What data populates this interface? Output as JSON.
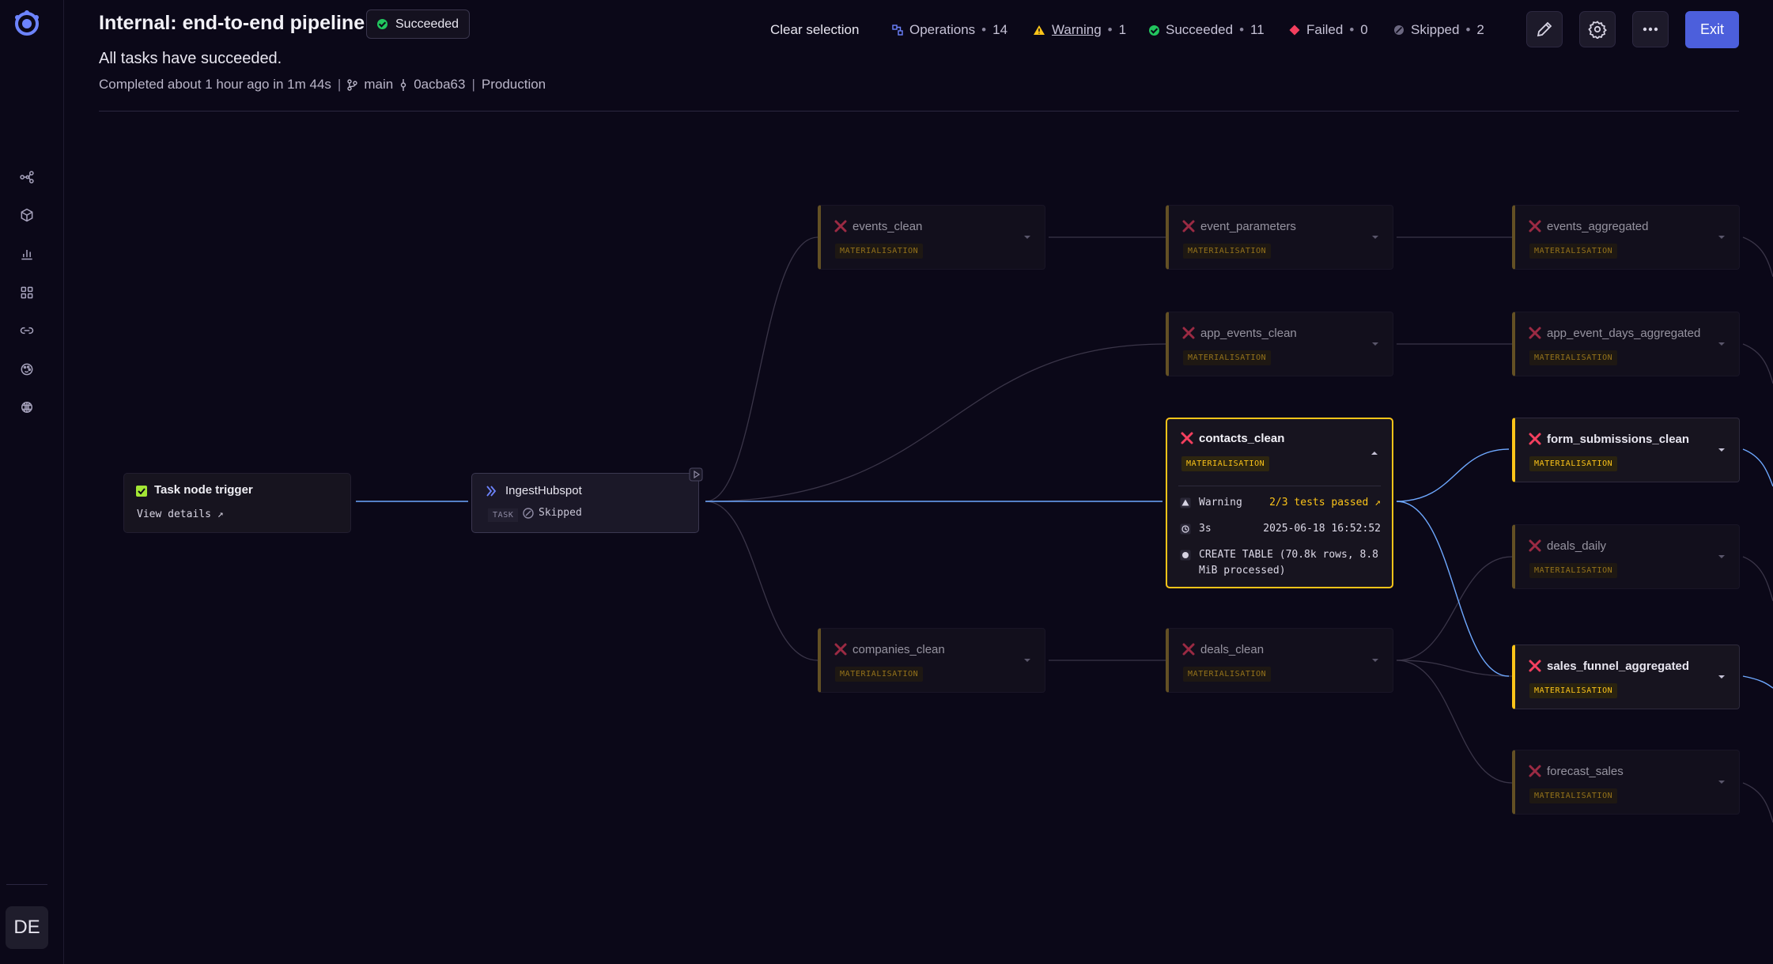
{
  "header": {
    "title": "Internal: end-to-end pipeline",
    "status": "Succeeded",
    "subtitle": "All tasks have succeeded.",
    "completed": "Completed about 1 hour ago in 1m 44s",
    "branch": "main",
    "commit": "0acba63",
    "environment": "Production"
  },
  "toolbar": {
    "clear_selection": "Clear selection",
    "operations_label": "Operations",
    "operations_count": "14",
    "warning_label": "Warning",
    "warning_count": "1",
    "succeeded_label": "Succeeded",
    "succeeded_count": "11",
    "failed_label": "Failed",
    "failed_count": "0",
    "skipped_label": "Skipped",
    "skipped_count": "2",
    "exit_label": "Exit"
  },
  "sidebar": {
    "avatar_initials": "DE",
    "icons": [
      "lineage-icon",
      "cube-icon",
      "bar-chart-icon",
      "grid-icon",
      "link-icon",
      "palette-icon",
      "brain-icon"
    ]
  },
  "trigger": {
    "title": "Task node trigger",
    "link": "View details ↗"
  },
  "ingest": {
    "title": "IngestHubspot",
    "badge": "TASK",
    "status": "Skipped"
  },
  "nodes": {
    "events_clean": {
      "title": "events_clean",
      "badge": "MATERIALISATION"
    },
    "event_parameters": {
      "title": "event_parameters",
      "badge": "MATERIALISATION"
    },
    "events_aggregated": {
      "title": "events_aggregated",
      "badge": "MATERIALISATION"
    },
    "app_events_clean": {
      "title": "app_events_clean",
      "badge": "MATERIALISATION"
    },
    "app_event_days_aggregated": {
      "title": "app_event_days_aggregated",
      "badge": "MATERIALISATION"
    },
    "form_submissions_clean": {
      "title": "form_submissions_clean",
      "badge": "MATERIALISATION"
    },
    "deals_daily": {
      "title": "deals_daily",
      "badge": "MATERIALISATION"
    },
    "companies_clean": {
      "title": "companies_clean",
      "badge": "MATERIALISATION"
    },
    "deals_clean": {
      "title": "deals_clean",
      "badge": "MATERIALISATION"
    },
    "sales_funnel_aggregated": {
      "title": "sales_funnel_aggregated",
      "badge": "MATERIALISATION"
    },
    "forecast_sales": {
      "title": "forecast_sales",
      "badge": "MATERIALISATION"
    }
  },
  "contacts": {
    "title": "contacts_clean",
    "badge": "MATERIALISATION",
    "warning_label": "Warning",
    "tests": "2/3 tests passed ↗",
    "duration": "3s",
    "timestamp": "2025-06-18 16:52:52",
    "query": "CREATE TABLE (70.8k rows, 8.8 MiB processed)"
  },
  "colors": {
    "accent": "#4c5fdc",
    "warning": "#fcc419",
    "success": "#22c55e",
    "failed": "#f43f5e",
    "edge_highlight": "#6ea8ff"
  }
}
